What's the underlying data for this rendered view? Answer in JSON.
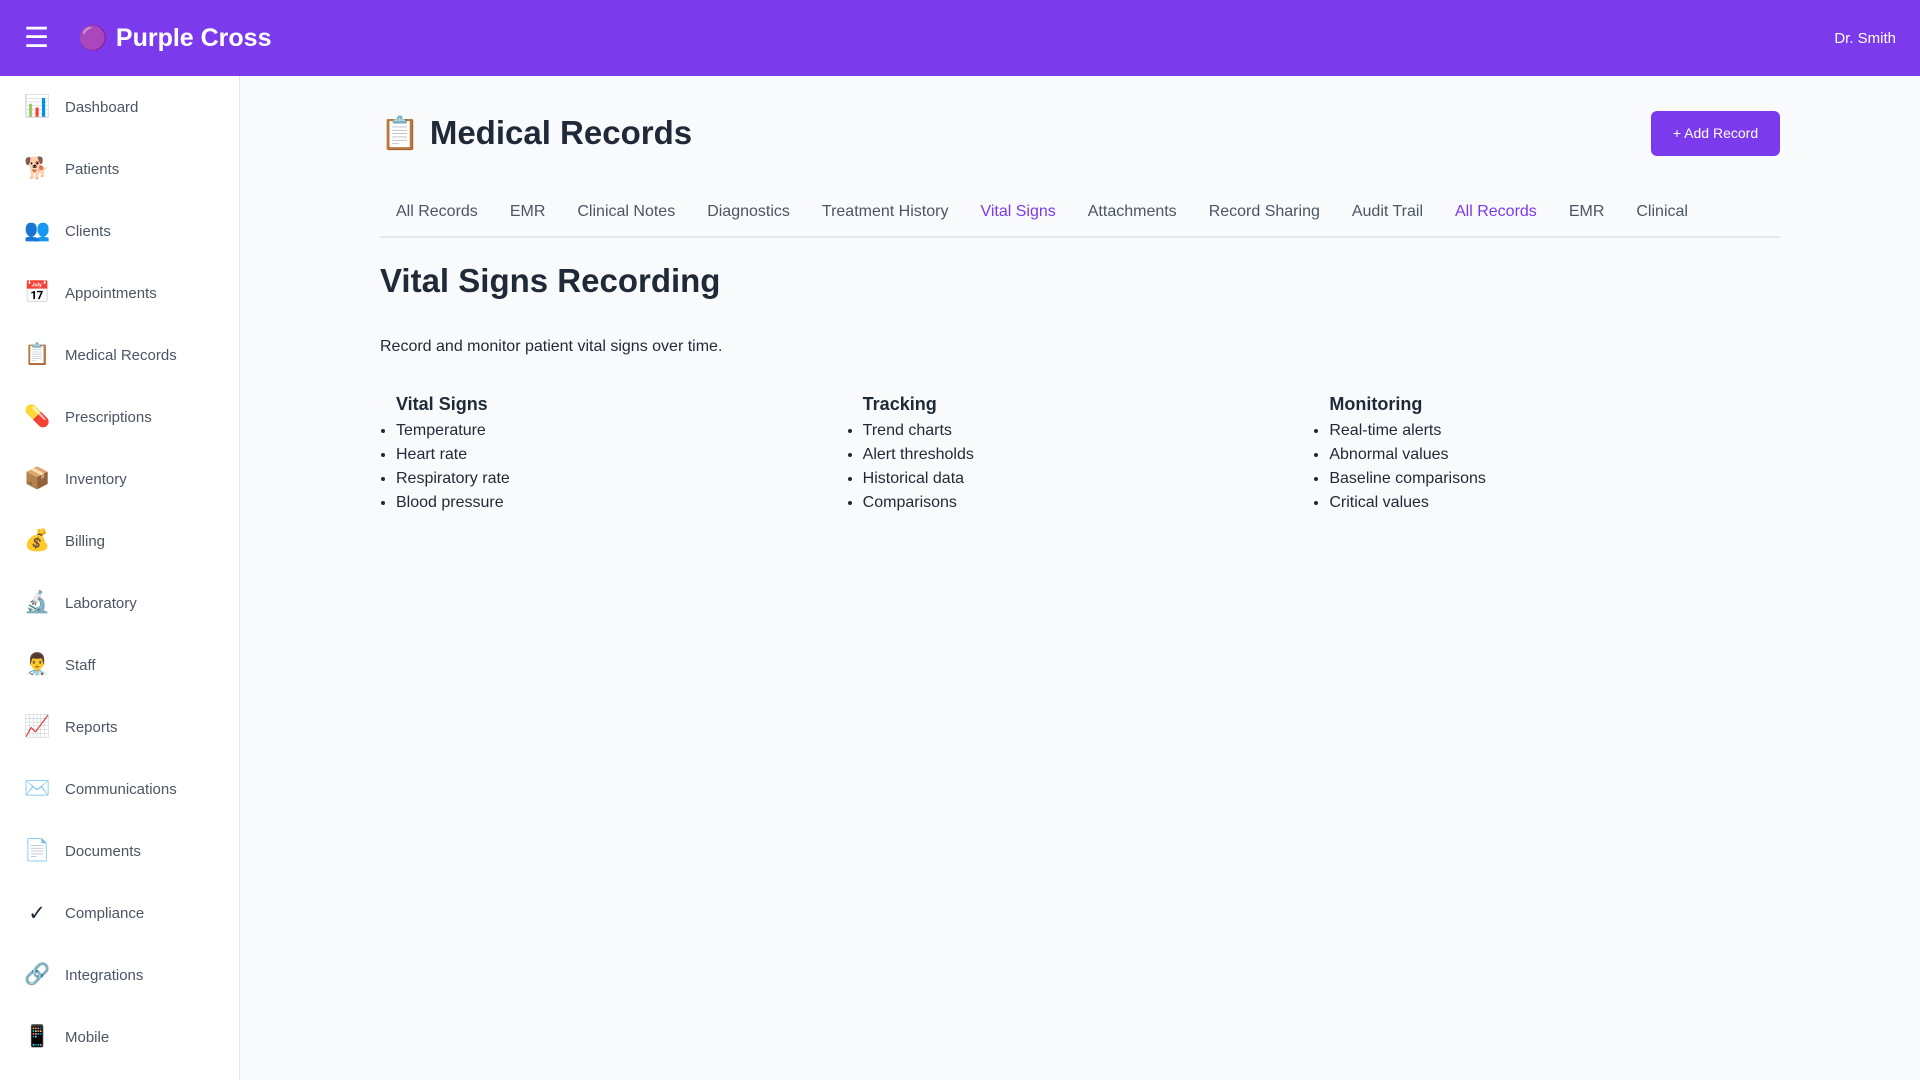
{
  "header": {
    "menu_icon": "☰",
    "brand_logo": "🟣",
    "brand": "Purple Cross",
    "user": "Dr. Smith"
  },
  "sidebar": {
    "items": [
      {
        "icon": "📊",
        "icon_name": "chart-icon",
        "label": "Dashboard"
      },
      {
        "icon": "🐕",
        "icon_name": "dog-icon",
        "label": "Patients"
      },
      {
        "icon": "👥",
        "icon_name": "people-icon",
        "label": "Clients"
      },
      {
        "icon": "📅",
        "icon_name": "calendar-icon",
        "label": "Appointments"
      },
      {
        "icon": "📋",
        "icon_name": "clipboard-icon",
        "label": "Medical Records"
      },
      {
        "icon": "💊",
        "icon_name": "pill-icon",
        "label": "Prescriptions"
      },
      {
        "icon": "📦",
        "icon_name": "package-icon",
        "label": "Inventory"
      },
      {
        "icon": "💰",
        "icon_name": "money-bag-icon",
        "label": "Billing"
      },
      {
        "icon": "🔬",
        "icon_name": "microscope-icon",
        "label": "Laboratory"
      },
      {
        "icon": "👨‍⚕️",
        "icon_name": "doctor-icon",
        "label": "Staff"
      },
      {
        "icon": "📈",
        "icon_name": "trend-chart-icon",
        "label": "Reports"
      },
      {
        "icon": "✉️",
        "icon_name": "envelope-icon",
        "label": "Communications"
      },
      {
        "icon": "📄",
        "icon_name": "document-icon",
        "label": "Documents"
      },
      {
        "icon": "✓",
        "icon_name": "checkmark-icon",
        "label": "Compliance"
      },
      {
        "icon": "🔗",
        "icon_name": "link-icon",
        "label": "Integrations"
      },
      {
        "icon": "📱",
        "icon_name": "phone-icon",
        "label": "Mobile"
      }
    ]
  },
  "main": {
    "title_icon": "📋",
    "title": "Medical Records",
    "add_button": "+ Add Record",
    "tabs": [
      {
        "label": "All Records",
        "active": false
      },
      {
        "label": "EMR",
        "active": false
      },
      {
        "label": "Clinical Notes",
        "active": false
      },
      {
        "label": "Diagnostics",
        "active": false
      },
      {
        "label": "Treatment History",
        "active": false
      },
      {
        "label": "Vital Signs",
        "active": true
      },
      {
        "label": "Attachments",
        "active": false
      },
      {
        "label": "Record Sharing",
        "active": false
      },
      {
        "label": "Audit Trail",
        "active": false
      },
      {
        "label": "All Records",
        "active": true
      },
      {
        "label": "EMR",
        "active": false
      },
      {
        "label": "Clinical",
        "active": false
      }
    ],
    "section_title": "Vital Signs Recording",
    "section_desc": "Record and monitor patient vital signs over time.",
    "columns": [
      {
        "title": "Vital Signs",
        "items": [
          "Temperature",
          "Heart rate",
          "Respiratory rate",
          "Blood pressure"
        ]
      },
      {
        "title": "Tracking",
        "items": [
          "Trend charts",
          "Alert thresholds",
          "Historical data",
          "Comparisons"
        ]
      },
      {
        "title": "Monitoring",
        "items": [
          "Real-time alerts",
          "Abnormal values",
          "Baseline comparisons",
          "Critical values"
        ]
      }
    ]
  },
  "colors": {
    "accent": "#7c3aed",
    "text": "#1f2937",
    "muted": "#4b5563",
    "background": "#f9fafb"
  }
}
